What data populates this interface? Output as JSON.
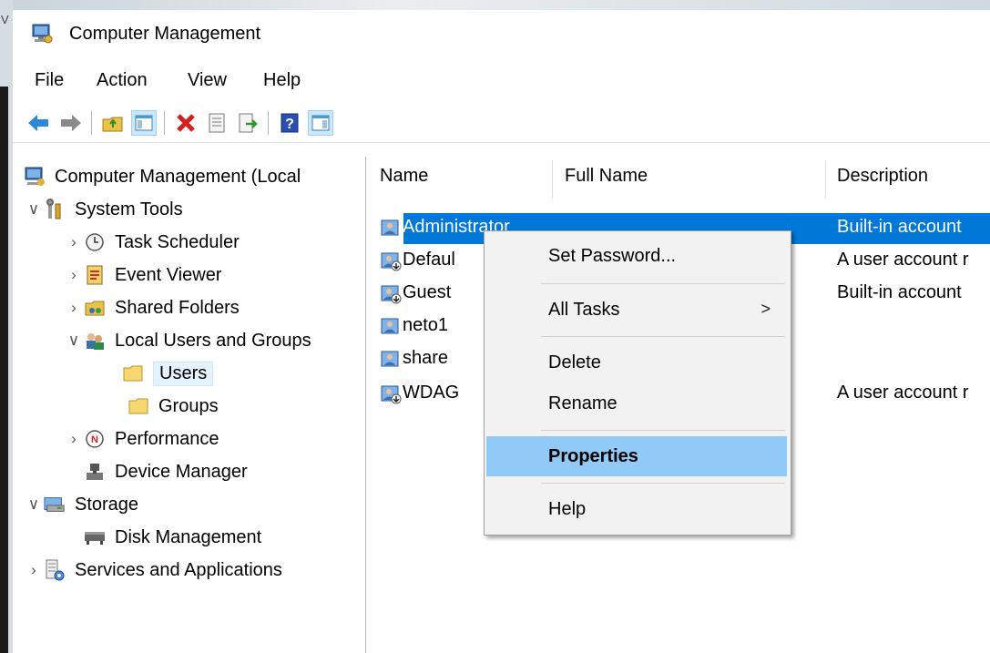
{
  "window": {
    "title": "Computer Management"
  },
  "menu": [
    "File",
    "Action",
    "View",
    "Help"
  ],
  "toolbar": [
    "back-icon",
    "forward-icon",
    "up-folder-icon",
    "show-hide-tree-icon",
    "delete-icon",
    "properties-icon",
    "export-list-icon",
    "help-icon",
    "show-hide-action-pane-icon"
  ],
  "tree": [
    {
      "label": "Computer Management (Local",
      "icon": "computer-management-icon",
      "arrow": ""
    },
    {
      "label": "System Tools",
      "icon": "system-tools-icon",
      "arrow": "expanded"
    },
    {
      "label": "Task Scheduler",
      "icon": "clock-icon",
      "arrow": "collapsed"
    },
    {
      "label": "Event Viewer",
      "icon": "event-viewer-icon",
      "arrow": "collapsed"
    },
    {
      "label": "Shared Folders",
      "icon": "shared-folder-icon",
      "arrow": "collapsed"
    },
    {
      "label": "Local Users and Groups",
      "icon": "users-groups-icon",
      "arrow": "expanded"
    },
    {
      "label": "Users",
      "icon": "folder-icon",
      "arrow": "",
      "selected": true
    },
    {
      "label": "Groups",
      "icon": "folder-icon",
      "arrow": ""
    },
    {
      "label": "Performance",
      "icon": "performance-icon",
      "arrow": "collapsed"
    },
    {
      "label": "Device Manager",
      "icon": "device-manager-icon",
      "arrow": ""
    },
    {
      "label": "Storage",
      "icon": "storage-icon",
      "arrow": "expanded"
    },
    {
      "label": "Disk Management",
      "icon": "disk-icon",
      "arrow": ""
    },
    {
      "label": "Services and Applications",
      "icon": "services-icon",
      "arrow": "collapsed"
    }
  ],
  "list": {
    "columns": [
      "Name",
      "Full Name",
      "Description"
    ],
    "rows": [
      {
        "name": "Administrator",
        "full_name": "",
        "description": "Built-in account",
        "disabled": false,
        "selected": true
      },
      {
        "name": "Defaul",
        "full_name": "",
        "description": "A user account r",
        "disabled": true
      },
      {
        "name": "Guest",
        "full_name": "",
        "description": "Built-in account",
        "disabled": true
      },
      {
        "name": "neto1",
        "full_name": "",
        "description": "",
        "disabled": false
      },
      {
        "name": "share",
        "full_name": "",
        "description": "",
        "disabled": false
      },
      {
        "name": "WDAG",
        "full_name": "",
        "description": "A user account r",
        "disabled": true
      }
    ]
  },
  "context_menu": {
    "items": [
      {
        "label": "Set Password...",
        "submenu": false
      },
      {
        "label": "All Tasks",
        "submenu": true,
        "submenu_glyph": ">"
      },
      {
        "label": "Delete",
        "submenu": false
      },
      {
        "label": "Rename",
        "submenu": false
      },
      {
        "label": "Properties",
        "submenu": false,
        "bold": true,
        "highlighted": true
      },
      {
        "label": "Help",
        "submenu": false
      }
    ]
  },
  "colors": {
    "selection": "#0078d7",
    "menu_hover": "#91c9f7",
    "tree_selection": "#e5f3ff"
  }
}
